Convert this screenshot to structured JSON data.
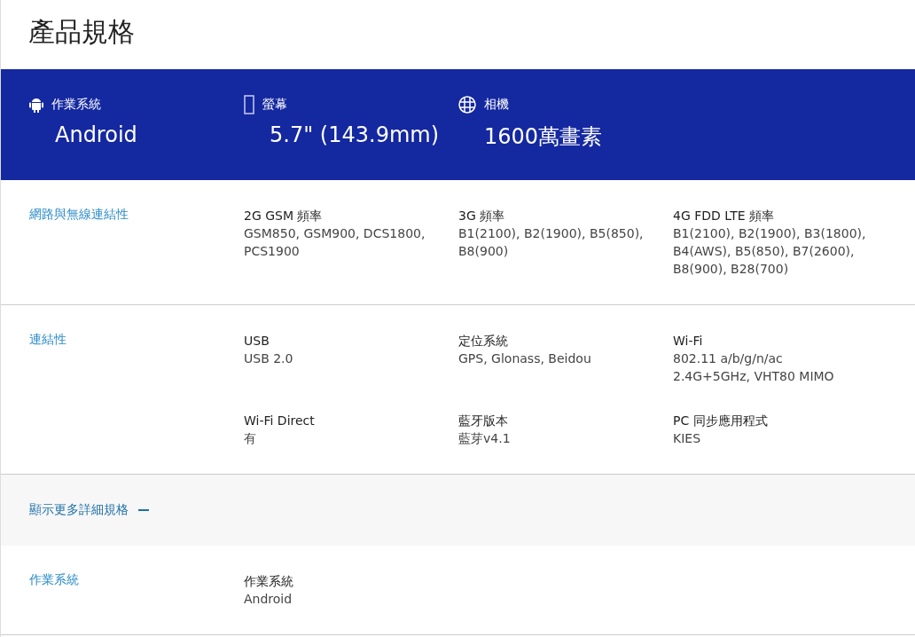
{
  "title": "產品規格",
  "highlights": [
    {
      "kind": "os",
      "label": "作業系統",
      "value": "Android"
    },
    {
      "kind": "screen",
      "label": "螢幕",
      "value": "5.7\" (143.9mm)"
    },
    {
      "kind": "camera",
      "label": "相機",
      "value": "1600萬畫素"
    }
  ],
  "sections": [
    {
      "name": "網路與無線連結性",
      "specs": [
        {
          "label": "2G GSM 頻率",
          "value": "GSM850, GSM900, DCS1800,\nPCS1900"
        },
        {
          "label": "3G 頻率",
          "value": "B1(2100), B2(1900), B5(850),\nB8(900)"
        },
        {
          "label": "4G FDD LTE 頻率",
          "value": "B1(2100), B2(1900), B3(1800),\nB4(AWS), B5(850), B7(2600),\nB8(900), B28(700)"
        }
      ]
    },
    {
      "name": "連結性",
      "specs": [
        {
          "label": "USB",
          "value": "USB 2.0"
        },
        {
          "label": "定位系統",
          "value": "GPS, Glonass, Beidou"
        },
        {
          "label": "Wi-Fi",
          "value": "802.11 a/b/g/n/ac\n2.4G+5GHz, VHT80 MIMO"
        },
        {
          "label": "Wi-Fi Direct",
          "value": "有"
        },
        {
          "label": "藍牙版本",
          "value": "藍芽v4.1"
        },
        {
          "label": "PC 同步應用程式",
          "value": "KIES"
        }
      ]
    }
  ],
  "more_toggle": {
    "label": "顯示更多詳細規格",
    "expanded": true
  },
  "more_sections": [
    {
      "name": "作業系統",
      "specs": [
        {
          "label": "作業系統",
          "value": "Android"
        }
      ]
    }
  ]
}
